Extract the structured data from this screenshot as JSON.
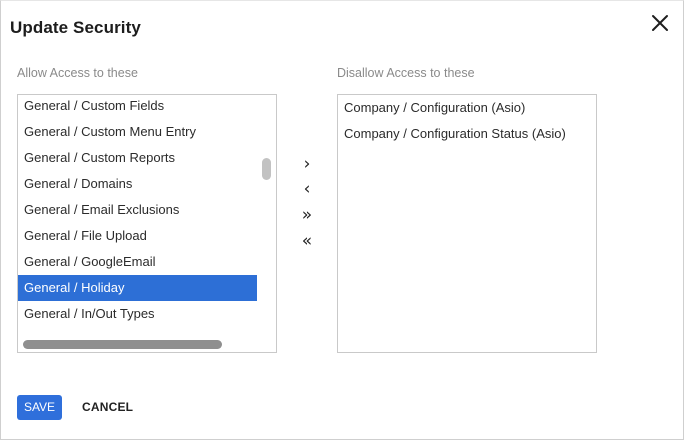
{
  "dialog": {
    "title": "Update Security",
    "close_icon": "close-icon"
  },
  "allow": {
    "label": "Allow Access to these",
    "items": [
      "General / Custom Fields",
      "General / Custom Menu Entry",
      "General / Custom Reports",
      "General / Domains",
      "General / Email Exclusions",
      "General / File Upload",
      "General / GoogleEmail",
      "General / Holiday",
      "General / In/Out Types"
    ],
    "selected": "General / Holiday"
  },
  "disallow": {
    "label": "Disallow Access to these",
    "items": [
      "Company / Configuration (Asio)",
      "Company / Configuration Status (Asio)"
    ]
  },
  "transfer": {
    "move_right": "›",
    "move_left": "‹",
    "move_all_right": "»",
    "move_all_left": "«"
  },
  "actions": {
    "save": "SAVE",
    "cancel": "CANCEL"
  },
  "colors": {
    "accent": "#2d6fd6",
    "selected_text": "#ffffff"
  }
}
